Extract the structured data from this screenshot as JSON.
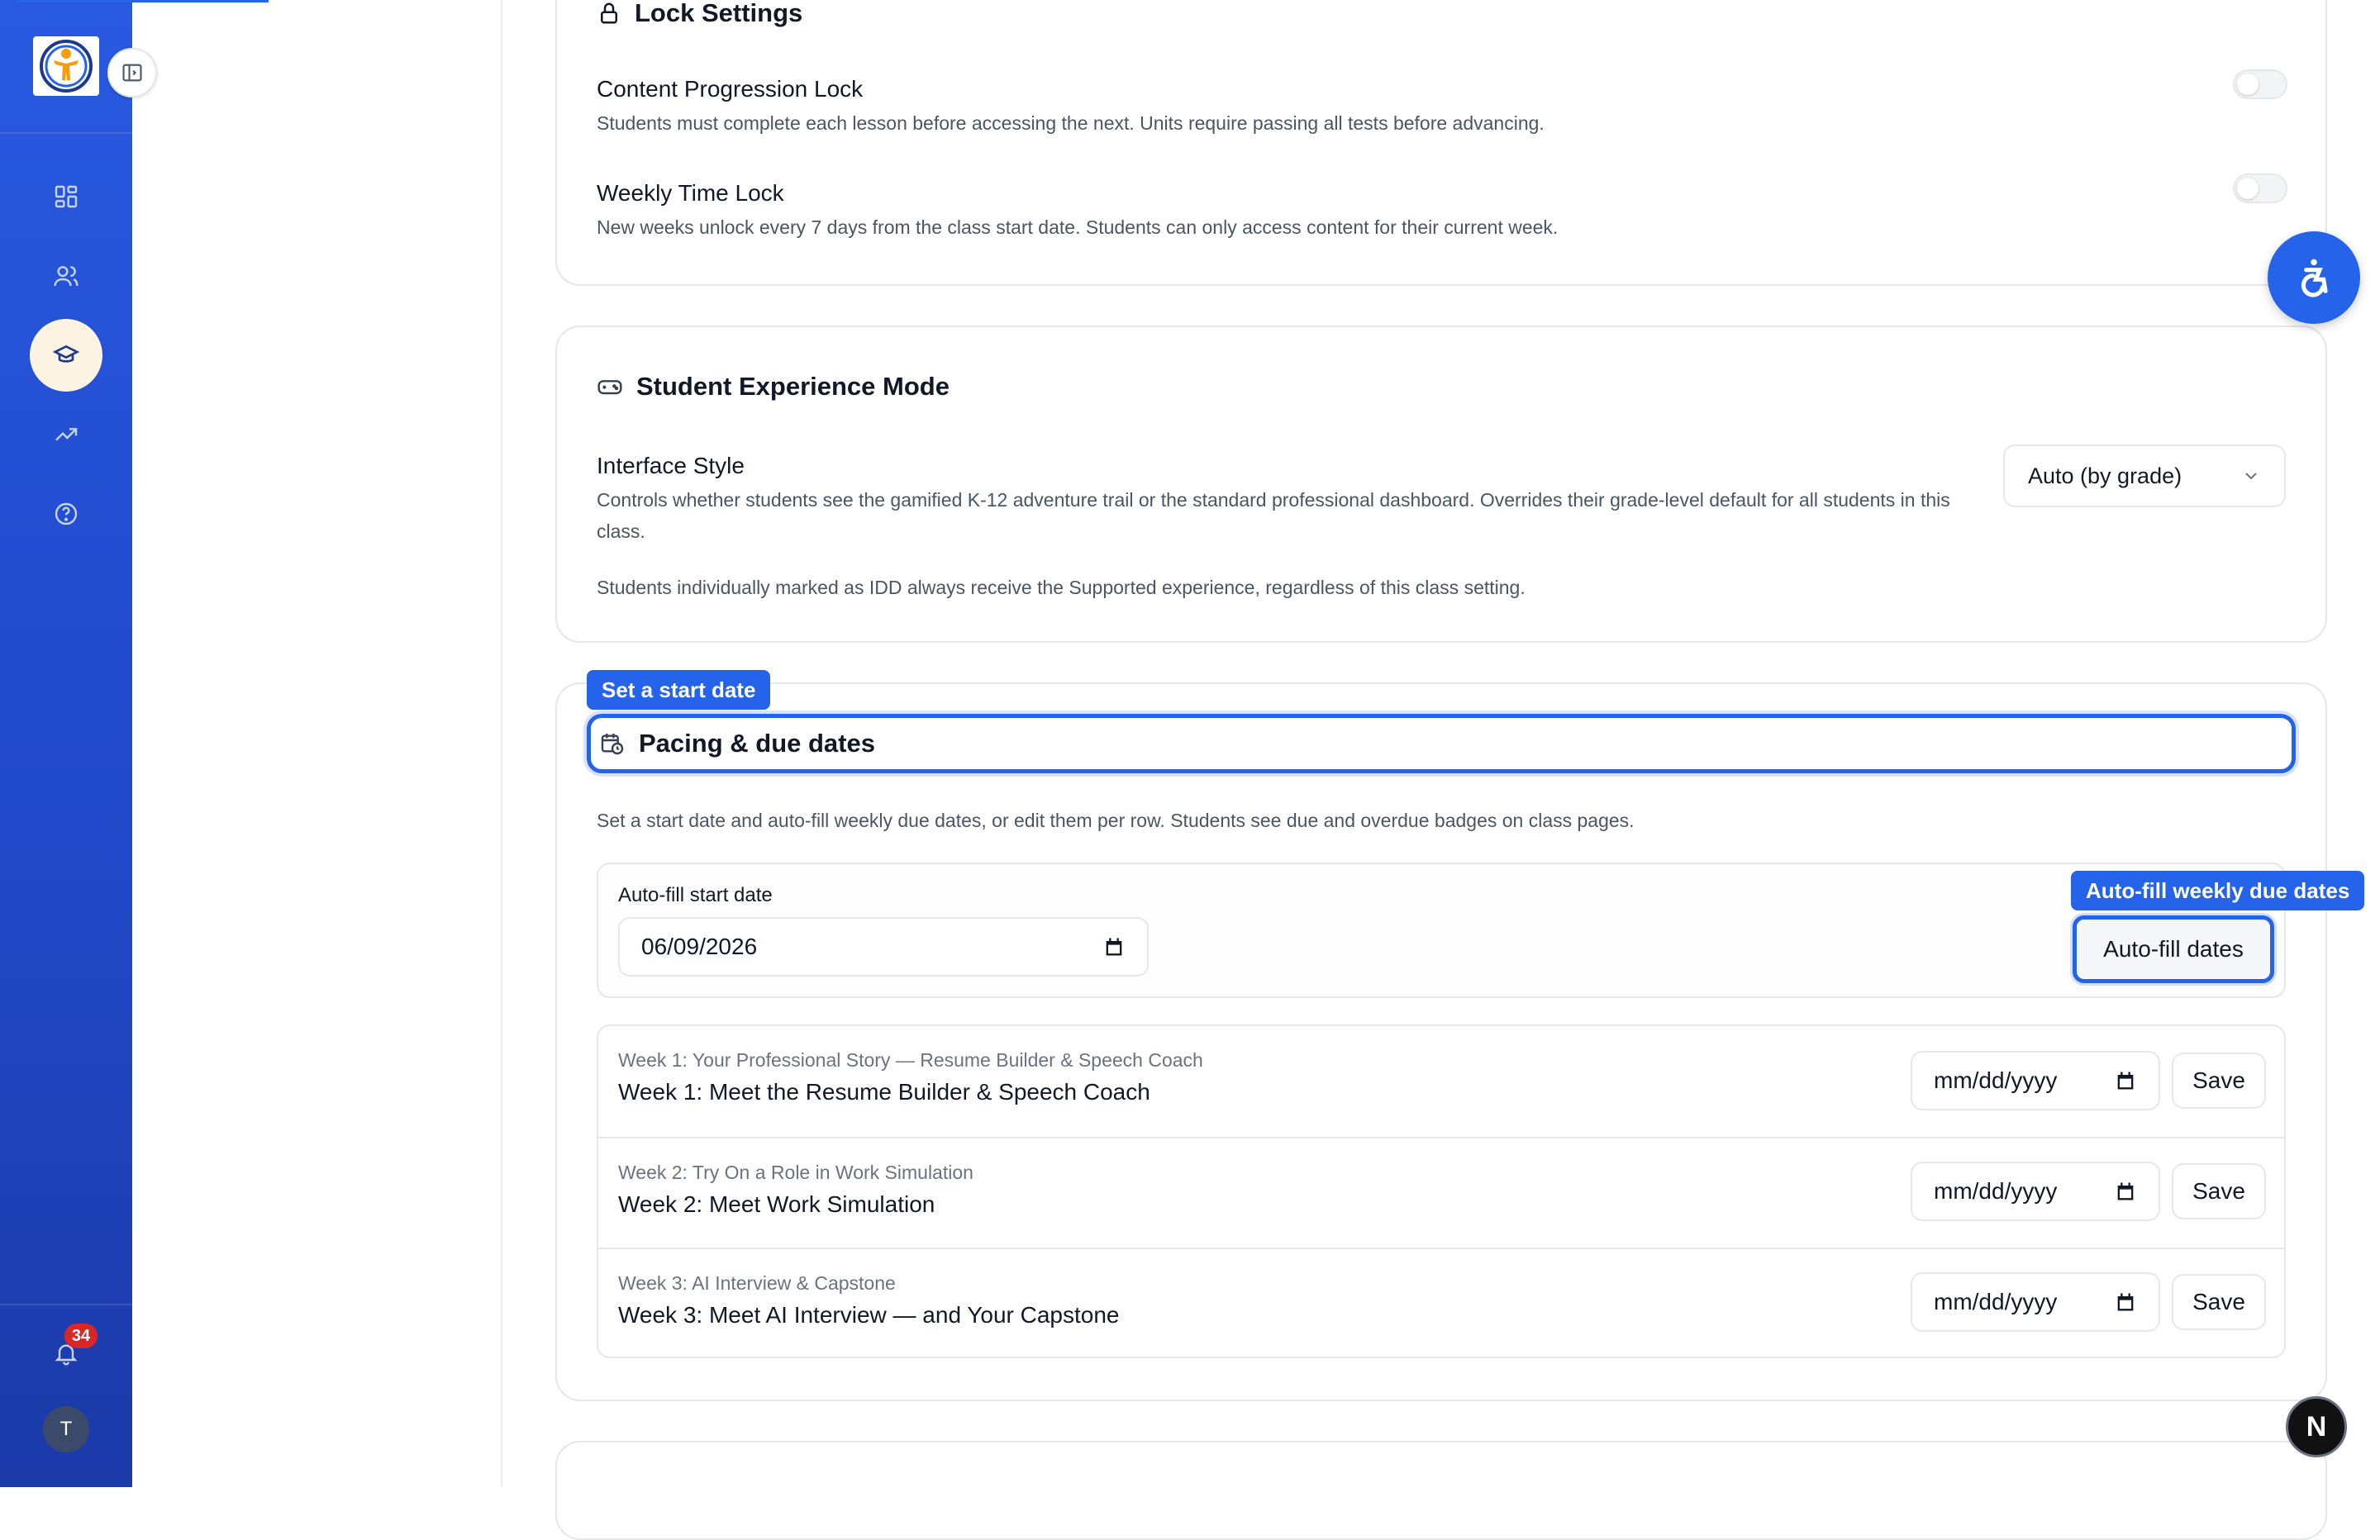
{
  "rail": {
    "nav_icons": [
      "dashboard-icon",
      "users-icon",
      "graduation-cap-icon",
      "trend-icon",
      "help-icon"
    ],
    "active_index": 2,
    "notification_count": "34",
    "avatar_initial": "T"
  },
  "lock_settings": {
    "title": "Lock Settings",
    "content_lock": {
      "label": "Content Progression Lock",
      "description": "Students must complete each lesson before accessing the next. Units require passing all tests before advancing.",
      "enabled": false
    },
    "weekly_lock": {
      "label": "Weekly Time Lock",
      "description": "New weeks unlock every 7 days from the class start date. Students can only access content for their current week.",
      "enabled": false
    }
  },
  "experience": {
    "title": "Student Experience Mode",
    "interface_label": "Interface Style",
    "interface_desc": "Controls whether students see the gamified K-12 adventure trail or the standard professional dashboard. Overrides their grade-level default for all students in this class.",
    "idd_note": "Students individually marked as IDD always receive the Supported experience, regardless of this class setting.",
    "select_value": "Auto (by grade)"
  },
  "pacing": {
    "tooltip_start": "Set a start date",
    "title": "Pacing & due dates",
    "description": "Set a start date and auto-fill weekly due dates, or edit them per row. Students see due and overdue badges on class pages.",
    "autofill_label": "Auto-fill start date",
    "start_date": "06/09/2026",
    "tooltip_autofill": "Auto-fill weekly due dates",
    "autofill_button": "Auto-fill dates",
    "date_placeholder": "mm/dd/yyyy",
    "save_label": "Save",
    "weeks": [
      {
        "subtitle": "Week 1: Your Professional Story — Resume Builder & Speech Coach",
        "title": "Week 1: Meet the Resume Builder & Speech Coach"
      },
      {
        "subtitle": "Week 2: Try On a Role in Work Simulation",
        "title": "Week 2: Meet Work Simulation"
      },
      {
        "subtitle": "Week 3: AI Interview & Capstone",
        "title": "Week 3: Meet AI Interview — and Your Capstone"
      }
    ]
  },
  "fab": {
    "n_badge": "N"
  },
  "colors": {
    "accent": "#2563eb",
    "rail": "#2149c9",
    "badge": "#dc2626"
  }
}
